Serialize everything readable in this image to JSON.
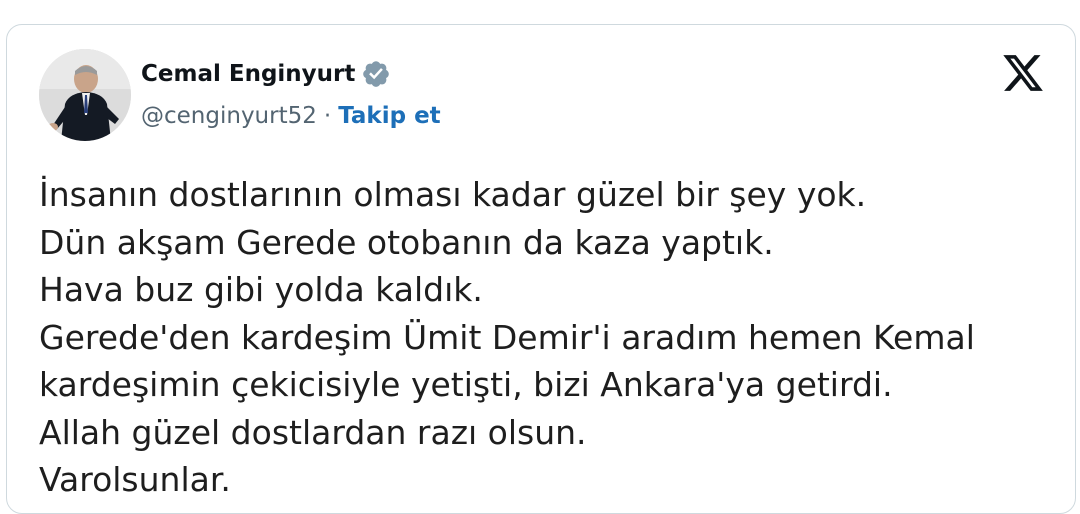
{
  "author": {
    "name": "Cemal Enginyurt",
    "handle": "@cenginyurt52",
    "separator": "·",
    "follow_label": "Takip et",
    "verified": true,
    "avatar_icon": "person-at-podium-photo",
    "verified_icon": "verified-badge-icon"
  },
  "brand": {
    "logo_icon": "x-logo-icon"
  },
  "tweet": {
    "lines": [
      "İnsanın dostlarının olması kadar güzel bir şey yok.",
      "Dün akşam Gerede otobanın da kaza yaptık.",
      "Hava buz gibi yolda kaldık.",
      "Gerede'den kardeşim Ümit Demir'i aradım hemen Kemal",
      "kardeşimin çekicisiyle yetişti, bizi Ankara'ya getirdi.",
      "Allah güzel dostlardan razı olsun.",
      "Varolsunlar."
    ]
  },
  "colors": {
    "link": "#1d6fb8",
    "muted_text": "#536471",
    "border": "#cfd9de",
    "verified_badge": "#829aab"
  }
}
